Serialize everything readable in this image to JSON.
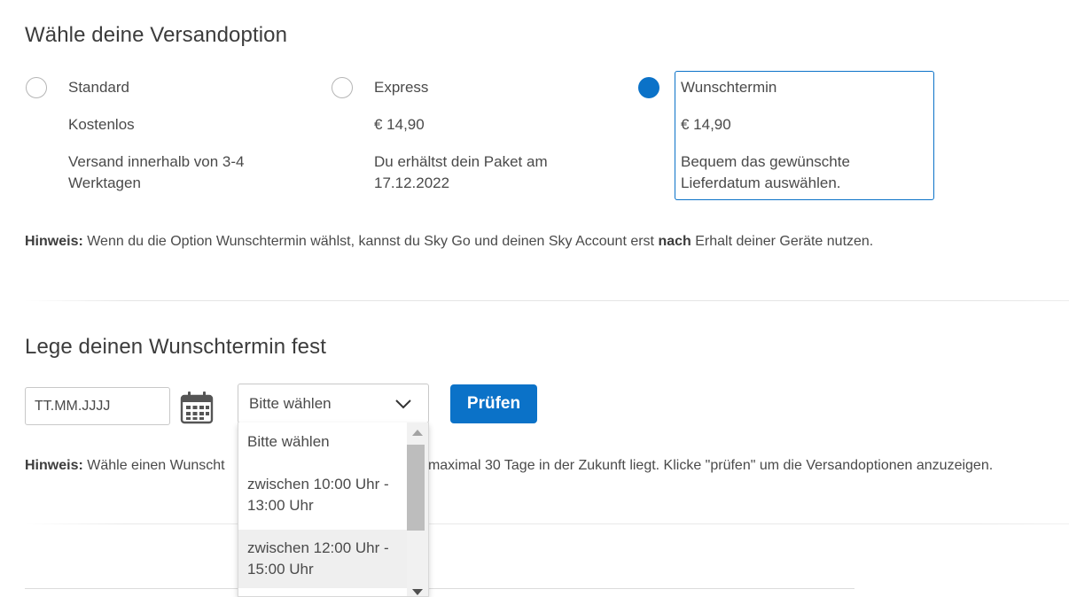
{
  "shipping": {
    "title": "Wähle deine Versandoption",
    "options": [
      {
        "name": "Standard",
        "price": "Kostenlos",
        "description": "Versand innerhalb von 3-4 Werktagen",
        "selected": false
      },
      {
        "name": "Express",
        "price": "€ 14,90",
        "description": "Du erhältst dein Paket am 17.12.2022",
        "selected": false
      },
      {
        "name": "Wunschtermin",
        "price": "€ 14,90",
        "description": "Bequem das gewünschte Lieferdatum auswählen.",
        "selected": true
      }
    ],
    "hint": {
      "label": "Hinweis:",
      "text_before": " Wenn du die Option Wunschtermin wählst, kannst du Sky Go und deinen Sky Account erst ",
      "emphasis": "nach",
      "text_after": " Erhalt deiner Geräte nutzen."
    }
  },
  "appointment": {
    "title": "Lege deinen Wunschtermin fest",
    "date_placeholder": "TT.MM.JJJJ",
    "calendar_icon": "calendar-icon",
    "time_select": {
      "selected": "Bitte wählen",
      "options": [
        "Bitte wählen",
        "zwischen 10:00 Uhr - 13:00 Uhr",
        "zwischen 12:00 Uhr - 15:00 Uhr"
      ],
      "highlighted_index": 2
    },
    "check_button": "Prüfen",
    "hint": {
      "label": "Hinweis:",
      "text_visible_left": " Wähle einen Wunscht",
      "text_visible_right": "d maximal 30 Tage in der Zukunft liegt. Klicke \"prüfen\" um die Versandoptionen anzuzeigen."
    }
  },
  "colors": {
    "accent": "#0b72c8",
    "text": "#4a4a4a",
    "border": "#c8c8c8"
  }
}
